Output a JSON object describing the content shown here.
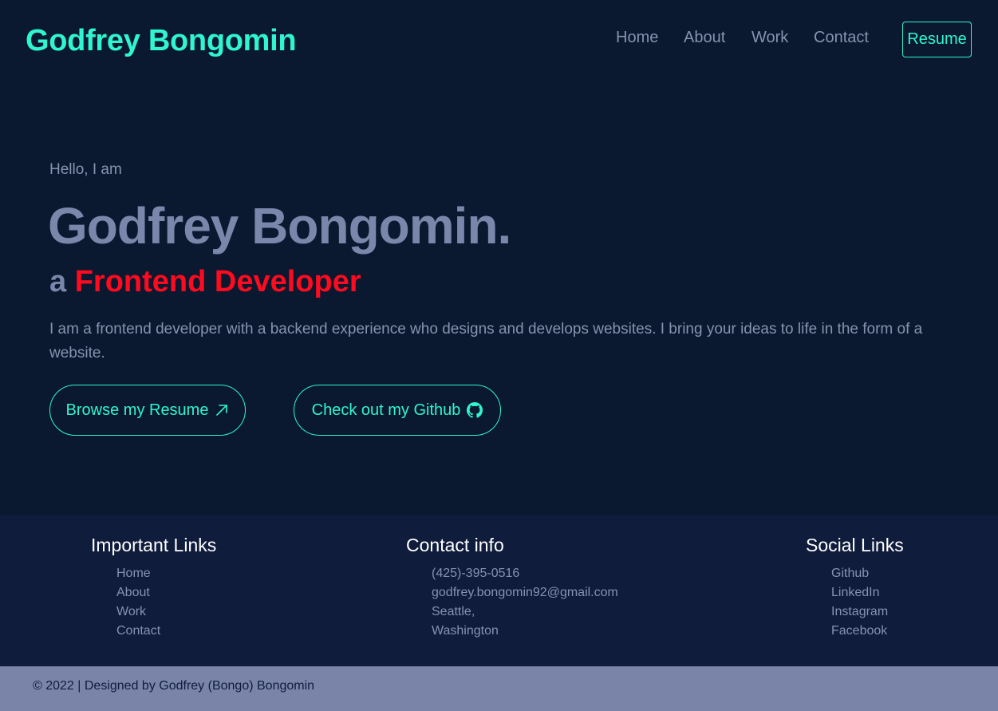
{
  "colors": {
    "background": "#0a192f",
    "accent": "#2ff5d1",
    "muted_text": "#8892b0",
    "headline": "#7b86ab",
    "role_highlight": "#ff0a1f",
    "footer_bg": "#0f1c3c",
    "copyright_bg": "#7a84a9"
  },
  "navbar": {
    "brand": "Godfrey Bongomin",
    "links": [
      "Home",
      "About",
      "Work",
      "Contact"
    ],
    "resume_label": "Resume"
  },
  "hero": {
    "greeting": "Hello, I am",
    "name": "Godfrey Bongomin.",
    "role_prefix": "a",
    "role": "Frontend Developer",
    "intro": "I am a frontend developer with a backend experience who designs and develops websites. I bring your ideas to life in the form of a website.",
    "buttons": {
      "resume": {
        "label": "Browse my Resume",
        "icon": "arrow-up-right-icon"
      },
      "github": {
        "label": "Check out my Github",
        "icon": "github-icon"
      }
    }
  },
  "footer": {
    "important_links": {
      "title": "Important Links",
      "items": [
        "Home",
        "About",
        "Work",
        "Contact"
      ]
    },
    "contact_info": {
      "title": "Contact info",
      "items": [
        "(425)-395-0516",
        "godfrey.bongomin92@gmail.com",
        "Seattle,",
        "Washington"
      ]
    },
    "social_links": {
      "title": "Social Links",
      "items": [
        "Github",
        "LinkedIn",
        "Instagram",
        "Facebook"
      ]
    }
  },
  "copyright": {
    "text": "© 2022 | Designed by Godfrey (Bongo) Bongomin"
  }
}
